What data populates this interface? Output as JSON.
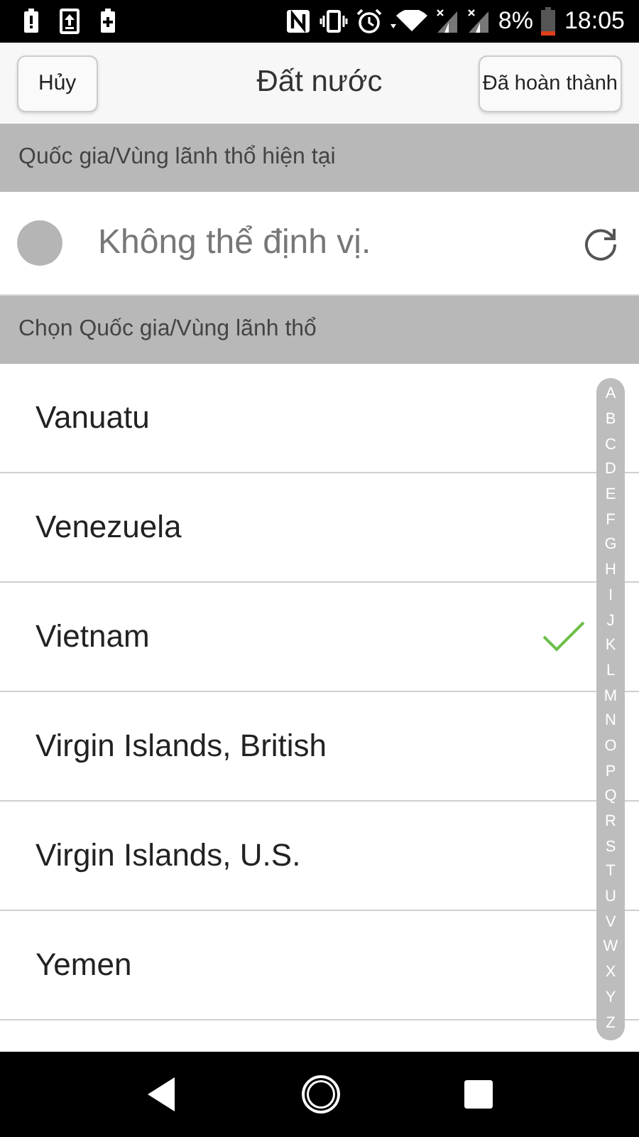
{
  "status_bar": {
    "battery_percent": "8%",
    "time": "18:05"
  },
  "header": {
    "cancel": "Hủy",
    "title": "Đất nước",
    "done": "Đã hoàn thành"
  },
  "current_section": {
    "title": "Quốc gia/Vùng lãnh thổ hiện tại",
    "location": "Không thể định vị."
  },
  "choose_section": {
    "title": "Chọn Quốc gia/Vùng lãnh thổ"
  },
  "countries": [
    {
      "name": "Vanuatu",
      "selected": false
    },
    {
      "name": "Venezuela",
      "selected": false
    },
    {
      "name": "Vietnam",
      "selected": true
    },
    {
      "name": "Virgin Islands, British",
      "selected": false
    },
    {
      "name": "Virgin Islands, U.S.",
      "selected": false
    },
    {
      "name": "Yemen",
      "selected": false
    }
  ],
  "index_letters": [
    "A",
    "B",
    "C",
    "D",
    "E",
    "F",
    "G",
    "H",
    "I",
    "J",
    "K",
    "L",
    "M",
    "N",
    "O",
    "P",
    "Q",
    "R",
    "S",
    "T",
    "U",
    "V",
    "W",
    "X",
    "Y",
    "Z"
  ]
}
